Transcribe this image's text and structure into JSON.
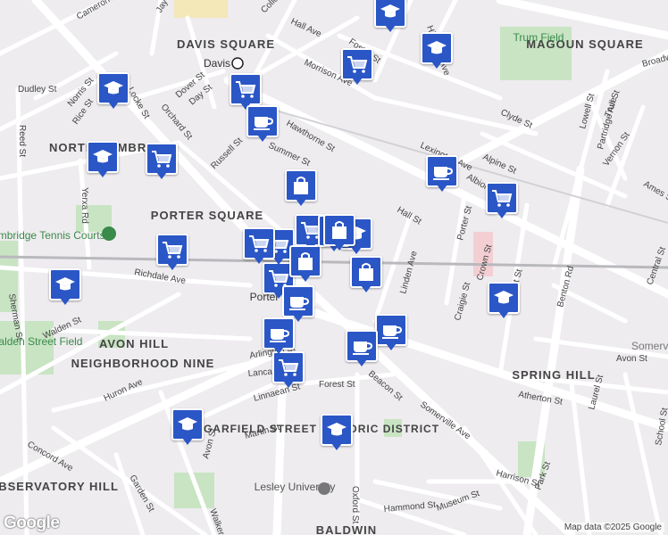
{
  "map": {
    "attribution": "Map data ©2025 Google",
    "logo_text": "Google",
    "colors": {
      "background": "#eeecef",
      "road": "#ffffff",
      "park": "#c8e4c3",
      "rail": "#b9b9bd",
      "highlight": "#f4e7b8",
      "marker": "#2a56c6",
      "label": "#333333"
    },
    "area_labels": [
      "DAVIS SQUARE",
      "MAGOUN SQUARE",
      "NORTH CAMBRIDGE",
      "PORTER SQUARE",
      "AVON HILL",
      "NEIGHBORHOOD NINE",
      "SPRING HILL",
      "GARFIELD STREET HISTORIC DISTRICT",
      "OBSERVATORY HILL",
      "BALDWIN"
    ],
    "poi_labels": [
      "Trum Field",
      "Davis",
      "Lesley University",
      "Porter",
      "Cambridge Tennis Courts",
      "Walden Street Field",
      "Somerville"
    ],
    "street_labels": [
      "Cameron Ave",
      "Jay St",
      "College Ave",
      "Hall Ave",
      "Foster St",
      "Morrison Ave",
      "Highland Ave",
      "Broadway",
      "Dover St",
      "Orchard St",
      "Day St",
      "Locke St",
      "Norris St",
      "Rice St",
      "Dudley St",
      "Reed St",
      "Hawthorne St",
      "Summer St",
      "Lexington Ave",
      "Alpine St",
      "Albion St",
      "Clyde St",
      "Lowell St",
      "Trull St",
      "Partridge Ave",
      "Vernon St",
      "Ames St",
      "Russell St",
      "Yerxa Rd",
      "Hall St",
      "Porter St",
      "Crown St",
      "Belmont St",
      "Central St",
      "Richdale Ave",
      "Linden Ave",
      "Craigie St",
      "Benton Rd",
      "Sherman St",
      "Walden St",
      "Arlington St",
      "Lancaster St",
      "Forest St",
      "Somerville Ave",
      "Beacon St",
      "Avon St",
      "Atherton St",
      "Laurel St",
      "Huron Ave",
      "Linnaean St",
      "Martin St",
      "Avon St",
      "Concord Ave",
      "Garden St",
      "Walker St",
      "Oxford St",
      "Hammond St",
      "Museum St",
      "Harrison St",
      "Park St",
      "School St"
    ],
    "markers": [
      {
        "icon": "school"
      },
      {
        "icon": "school"
      },
      {
        "icon": "school"
      },
      {
        "icon": "school"
      },
      {
        "icon": "school"
      },
      {
        "icon": "school"
      },
      {
        "icon": "school"
      },
      {
        "icon": "school"
      },
      {
        "icon": "school"
      },
      {
        "icon": "grocery"
      },
      {
        "icon": "grocery"
      },
      {
        "icon": "grocery"
      },
      {
        "icon": "grocery"
      },
      {
        "icon": "grocery"
      },
      {
        "icon": "grocery"
      },
      {
        "icon": "grocery"
      },
      {
        "icon": "grocery"
      },
      {
        "icon": "grocery"
      },
      {
        "icon": "grocery"
      },
      {
        "icon": "cafe"
      },
      {
        "icon": "cafe"
      },
      {
        "icon": "cafe"
      },
      {
        "icon": "cafe"
      },
      {
        "icon": "cafe"
      },
      {
        "icon": "cafe"
      },
      {
        "icon": "shopping"
      },
      {
        "icon": "shopping"
      },
      {
        "icon": "shopping"
      },
      {
        "icon": "shopping"
      },
      {
        "icon": "shopping"
      }
    ]
  }
}
